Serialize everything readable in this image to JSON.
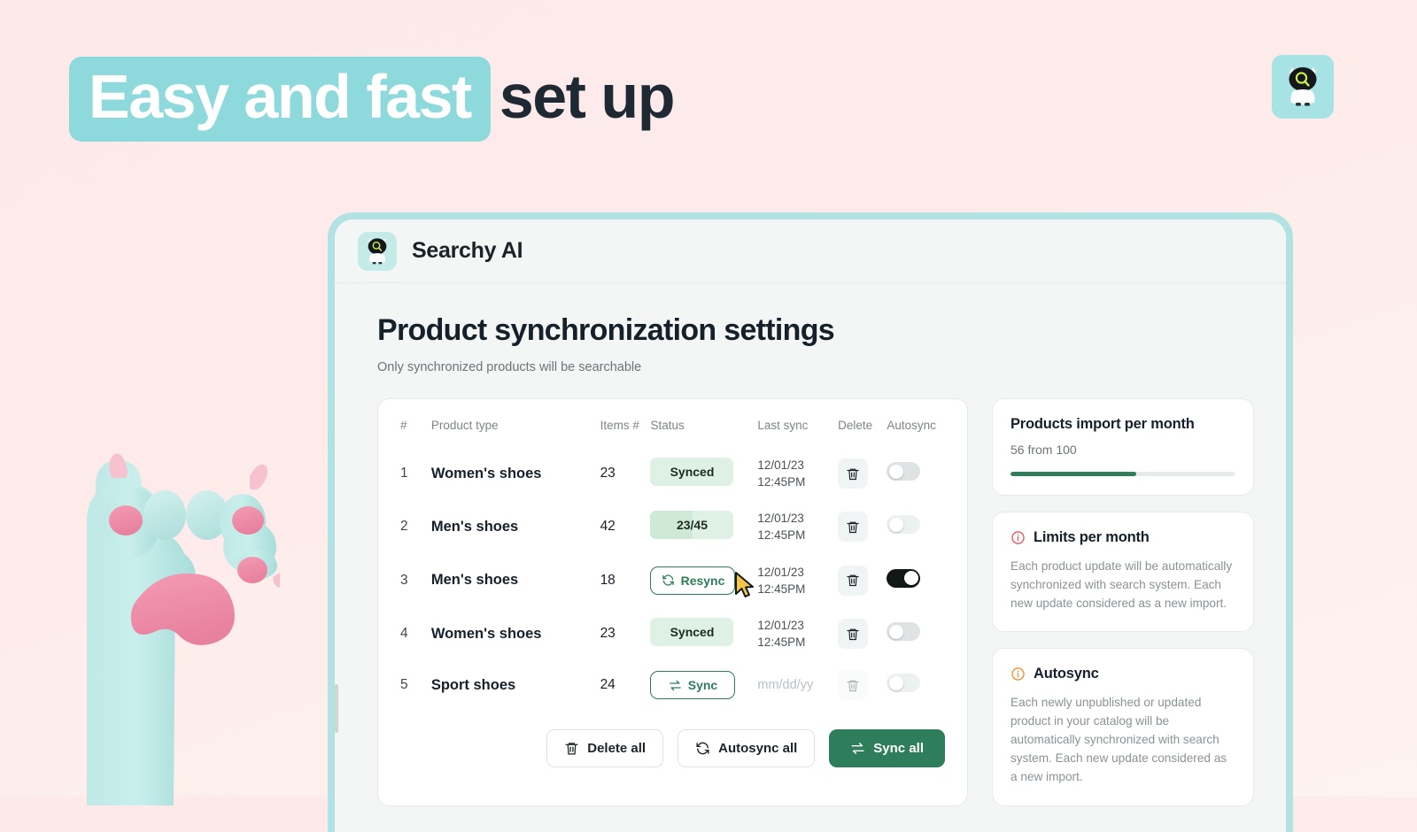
{
  "hero": {
    "highlight": "Easy and fast",
    "rest": "set up"
  },
  "brand": {
    "mascot_icon": "robot-search-mascot-icon",
    "badge_bg": "#a7e3e4"
  },
  "app": {
    "logo_icon": "robot-search-logo-icon",
    "name": "Searchy AI"
  },
  "page": {
    "title": "Product synchronization settings",
    "subtitle": "Only synchronized products will be searchable"
  },
  "table": {
    "headers": [
      "#",
      "Product type",
      "Items #",
      "Status",
      "Last sync",
      "Delete",
      "Autosync"
    ],
    "rows": [
      {
        "num": "1",
        "type": "Women's shoes",
        "items": "23",
        "status_kind": "badge",
        "status": "Synced",
        "progress": 0,
        "last_sync_date": "12/01/23",
        "last_sync_time": "12:45PM",
        "delete_enabled": true,
        "autosync": false
      },
      {
        "num": "2",
        "type": "Men's shoes",
        "items": "42",
        "status_kind": "badge-progress",
        "status": "23/45",
        "progress": 51,
        "last_sync_date": "12/01/23",
        "last_sync_time": "12:45PM",
        "delete_enabled": true,
        "autosync": false
      },
      {
        "num": "3",
        "type": "Men's shoes",
        "items": "18",
        "status_kind": "button-resync",
        "status": "Resync",
        "progress": 0,
        "last_sync_date": "12/01/23",
        "last_sync_time": "12:45PM",
        "delete_enabled": true,
        "autosync": true
      },
      {
        "num": "4",
        "type": "Women's shoes",
        "items": "23",
        "status_kind": "badge",
        "status": "Synced",
        "progress": 0,
        "last_sync_date": "12/01/23",
        "last_sync_time": "12:45PM",
        "delete_enabled": true,
        "autosync": false
      },
      {
        "num": "5",
        "type": "Sport shoes",
        "items": "24",
        "status_kind": "button-sync",
        "status": "Sync",
        "progress": 0,
        "last_sync_placeholder": "mm/dd/yy",
        "delete_enabled": false,
        "autosync": false
      }
    ],
    "actions": {
      "delete_all": "Delete all",
      "autosync_all": "Autosync all",
      "sync_all": "Sync all"
    }
  },
  "side": {
    "import_card": {
      "title": "Products import per month",
      "value_text": "56 from 100",
      "used": 56,
      "total": 100,
      "percent": 56,
      "bar_color": "#2f7d5b"
    },
    "limits_card": {
      "icon": "info-circle-icon",
      "icon_color": "#e8555f",
      "title": "Limits per month",
      "text": "Each product update will be automatically synchronized with search system. Each new update considered as a new import."
    },
    "autosync_card": {
      "icon": "info-circle-icon",
      "icon_color": "#f0922b",
      "title": "Autosync",
      "text": "Each newly unpublished or updated product in your catalog  will be automatically synchronized with search system. Each new update considered as a new import."
    }
  },
  "cursor": {
    "icon": "mouse-pointer-icon",
    "color": "#f3c64a"
  }
}
